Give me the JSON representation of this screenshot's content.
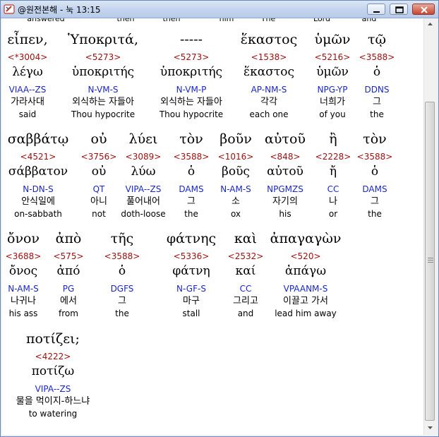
{
  "window": {
    "title": "@원전본해 - 눅 13:15",
    "icons": {
      "app": "bookmark-book-icon",
      "minimize": "minimize-icon",
      "maximize": "maximize-icon",
      "close": "close-icon"
    }
  },
  "partial_row": [
    "answered",
    "then",
    "then",
    "him",
    "The",
    "Lord",
    "and"
  ],
  "words": [
    {
      "greek": "εἶπεν,",
      "num": "<*3004>",
      "lemma": "λέγω",
      "parse": "VIAA--ZS",
      "kor": "가라사대",
      "eng": "said"
    },
    {
      "greek": "Ὑποκριτά,",
      "num": "<5273>",
      "lemma": "ὑποκριτής",
      "parse": "N-VM-S",
      "kor": "외식하는 자들아",
      "eng": "Thou hypocrite"
    },
    {
      "greek": "-----",
      "num": "<5273>",
      "lemma": "ὑποκριτής",
      "parse": "N-VM-P",
      "kor": "외식하는 자들아",
      "eng": "Thou hypocrite"
    },
    {
      "greek": "ἕκαστος",
      "num": "<1538>",
      "lemma": "ἕκαστος",
      "parse": "AP-NM-S",
      "kor": "각각",
      "eng": "each one"
    },
    {
      "greek": "ὑμῶν",
      "num": "<5216>",
      "lemma": "ὑμῶν",
      "parse": "NPG-YP",
      "kor": "너희가",
      "eng": "of you"
    },
    {
      "greek": "τῷ",
      "num": "<3588>",
      "lemma": "ὁ",
      "parse": "DDNS",
      "kor": "그",
      "eng": "the"
    },
    {
      "greek": "σαββάτῳ",
      "num": "<4521>",
      "lemma": "σάββατον",
      "parse": "N-DN-S",
      "kor": "안식일에",
      "eng": "on-sabbath"
    },
    {
      "greek": "οὐ",
      "num": "<3756>",
      "lemma": "οὐ",
      "parse": "QT",
      "kor": "아니",
      "eng": "not"
    },
    {
      "greek": "λύει",
      "num": "<3089>",
      "lemma": "λύω",
      "parse": "VIPA--ZS",
      "kor": "풀어내어",
      "eng": "doth-loose"
    },
    {
      "greek": "τὸν",
      "num": "<3588>",
      "lemma": "ὁ",
      "parse": "DAMS",
      "kor": "그",
      "eng": "the"
    },
    {
      "greek": "βοῦν",
      "num": "<1016>",
      "lemma": "βοῦς",
      "parse": "N-AM-S",
      "kor": "소",
      "eng": "ox"
    },
    {
      "greek": "αὐτοῦ",
      "num": "<848>",
      "lemma": "αὐτοῦ",
      "parse": "NPGMZS",
      "kor": "자기의",
      "eng": "his"
    },
    {
      "greek": "ἢ",
      "num": "<2228>",
      "lemma": "ἤ",
      "parse": "CC",
      "kor": "나",
      "eng": "or"
    },
    {
      "greek": "τὸν",
      "num": "<3588>",
      "lemma": "ὁ",
      "parse": "DAMS",
      "kor": "그",
      "eng": "the"
    },
    {
      "greek": "ὄνον",
      "num": "<3688>",
      "lemma": "ὄνος",
      "parse": "N-AM-S",
      "kor": "나귀나",
      "eng": "his ass"
    },
    {
      "greek": "ἀπὸ",
      "num": "<575>",
      "lemma": "ἀπό",
      "parse": "PG",
      "kor": "에서",
      "eng": "from"
    },
    {
      "greek": "τῆς",
      "num": "<3588>",
      "lemma": "ὁ",
      "parse": "DGFS",
      "kor": "그",
      "eng": "the"
    },
    {
      "greek": "φάτνης",
      "num": "<5336>",
      "lemma": "φάτνη",
      "parse": "N-GF-S",
      "kor": "마구",
      "eng": "stall"
    },
    {
      "greek": "καὶ",
      "num": "<2532>",
      "lemma": "καί",
      "parse": "CC",
      "kor": "그리고",
      "eng": "and"
    },
    {
      "greek": "ἀπαγαγὼν",
      "num": "<520>",
      "lemma": "ἀπάγω",
      "parse": "VPAANM-S",
      "kor": "이끌고 가서",
      "eng": "lead him away"
    },
    {
      "greek": "ποτίζει;",
      "num": "<4222>",
      "lemma": "ποτίζω",
      "parse": "VIPA--ZS",
      "kor": "물을 먹이지-하느냐",
      "eng": "to watering"
    }
  ]
}
